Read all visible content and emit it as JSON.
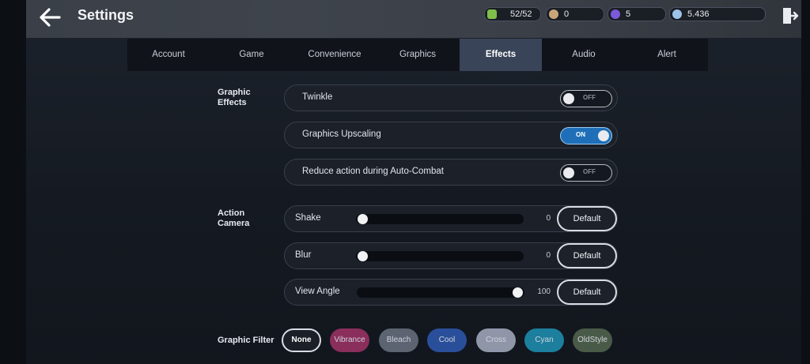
{
  "header": {
    "title": "Settings",
    "currencies": [
      {
        "value": "52/52",
        "icon": "stamina-icon",
        "color": "#7fbf4a"
      },
      {
        "value": "0",
        "icon": "coin-icon",
        "color": "#c8a67a"
      },
      {
        "value": "5",
        "icon": "orb-icon",
        "color": "#7a5ad8"
      },
      {
        "value": "5.436",
        "icon": "crystal-icon",
        "color": "#9ec3e8"
      }
    ]
  },
  "tabs": [
    {
      "label": "Account"
    },
    {
      "label": "Game"
    },
    {
      "label": "Convenience"
    },
    {
      "label": "Graphics"
    },
    {
      "label": "Effects",
      "active": true
    },
    {
      "label": "Audio"
    },
    {
      "label": "Alert"
    }
  ],
  "graphic_effects": {
    "label_line1": "Graphic",
    "label_line2": "Effects",
    "rows": [
      {
        "label": "Twinkle",
        "state": "OFF"
      },
      {
        "label": "Graphics Upscaling",
        "state": "ON"
      },
      {
        "label": "Reduce action during Auto-Combat",
        "state": "OFF"
      }
    ]
  },
  "action_camera": {
    "label_line1": "Action",
    "label_line2": "Camera",
    "default_label": "Default",
    "sliders": [
      {
        "label": "Shake",
        "value": "0",
        "fraction": 0
      },
      {
        "label": "Blur",
        "value": "0",
        "fraction": 0
      },
      {
        "label": "View Angle",
        "value": "100",
        "fraction": 1
      }
    ]
  },
  "graphic_filter": {
    "label": "Graphic Filter",
    "selected": "None",
    "options": [
      {
        "label": "None",
        "color": "#1a1f28"
      },
      {
        "label": "Vibrance",
        "color": "#8a2e5c"
      },
      {
        "label": "Bleach",
        "color": "#5b6470"
      },
      {
        "label": "Cool",
        "color": "#2a4f9a"
      },
      {
        "label": "Cross",
        "color": "#8f96a8"
      },
      {
        "label": "Cyan",
        "color": "#1c7f9e"
      },
      {
        "label": "OldStyle",
        "color": "#4a5a48"
      }
    ]
  }
}
